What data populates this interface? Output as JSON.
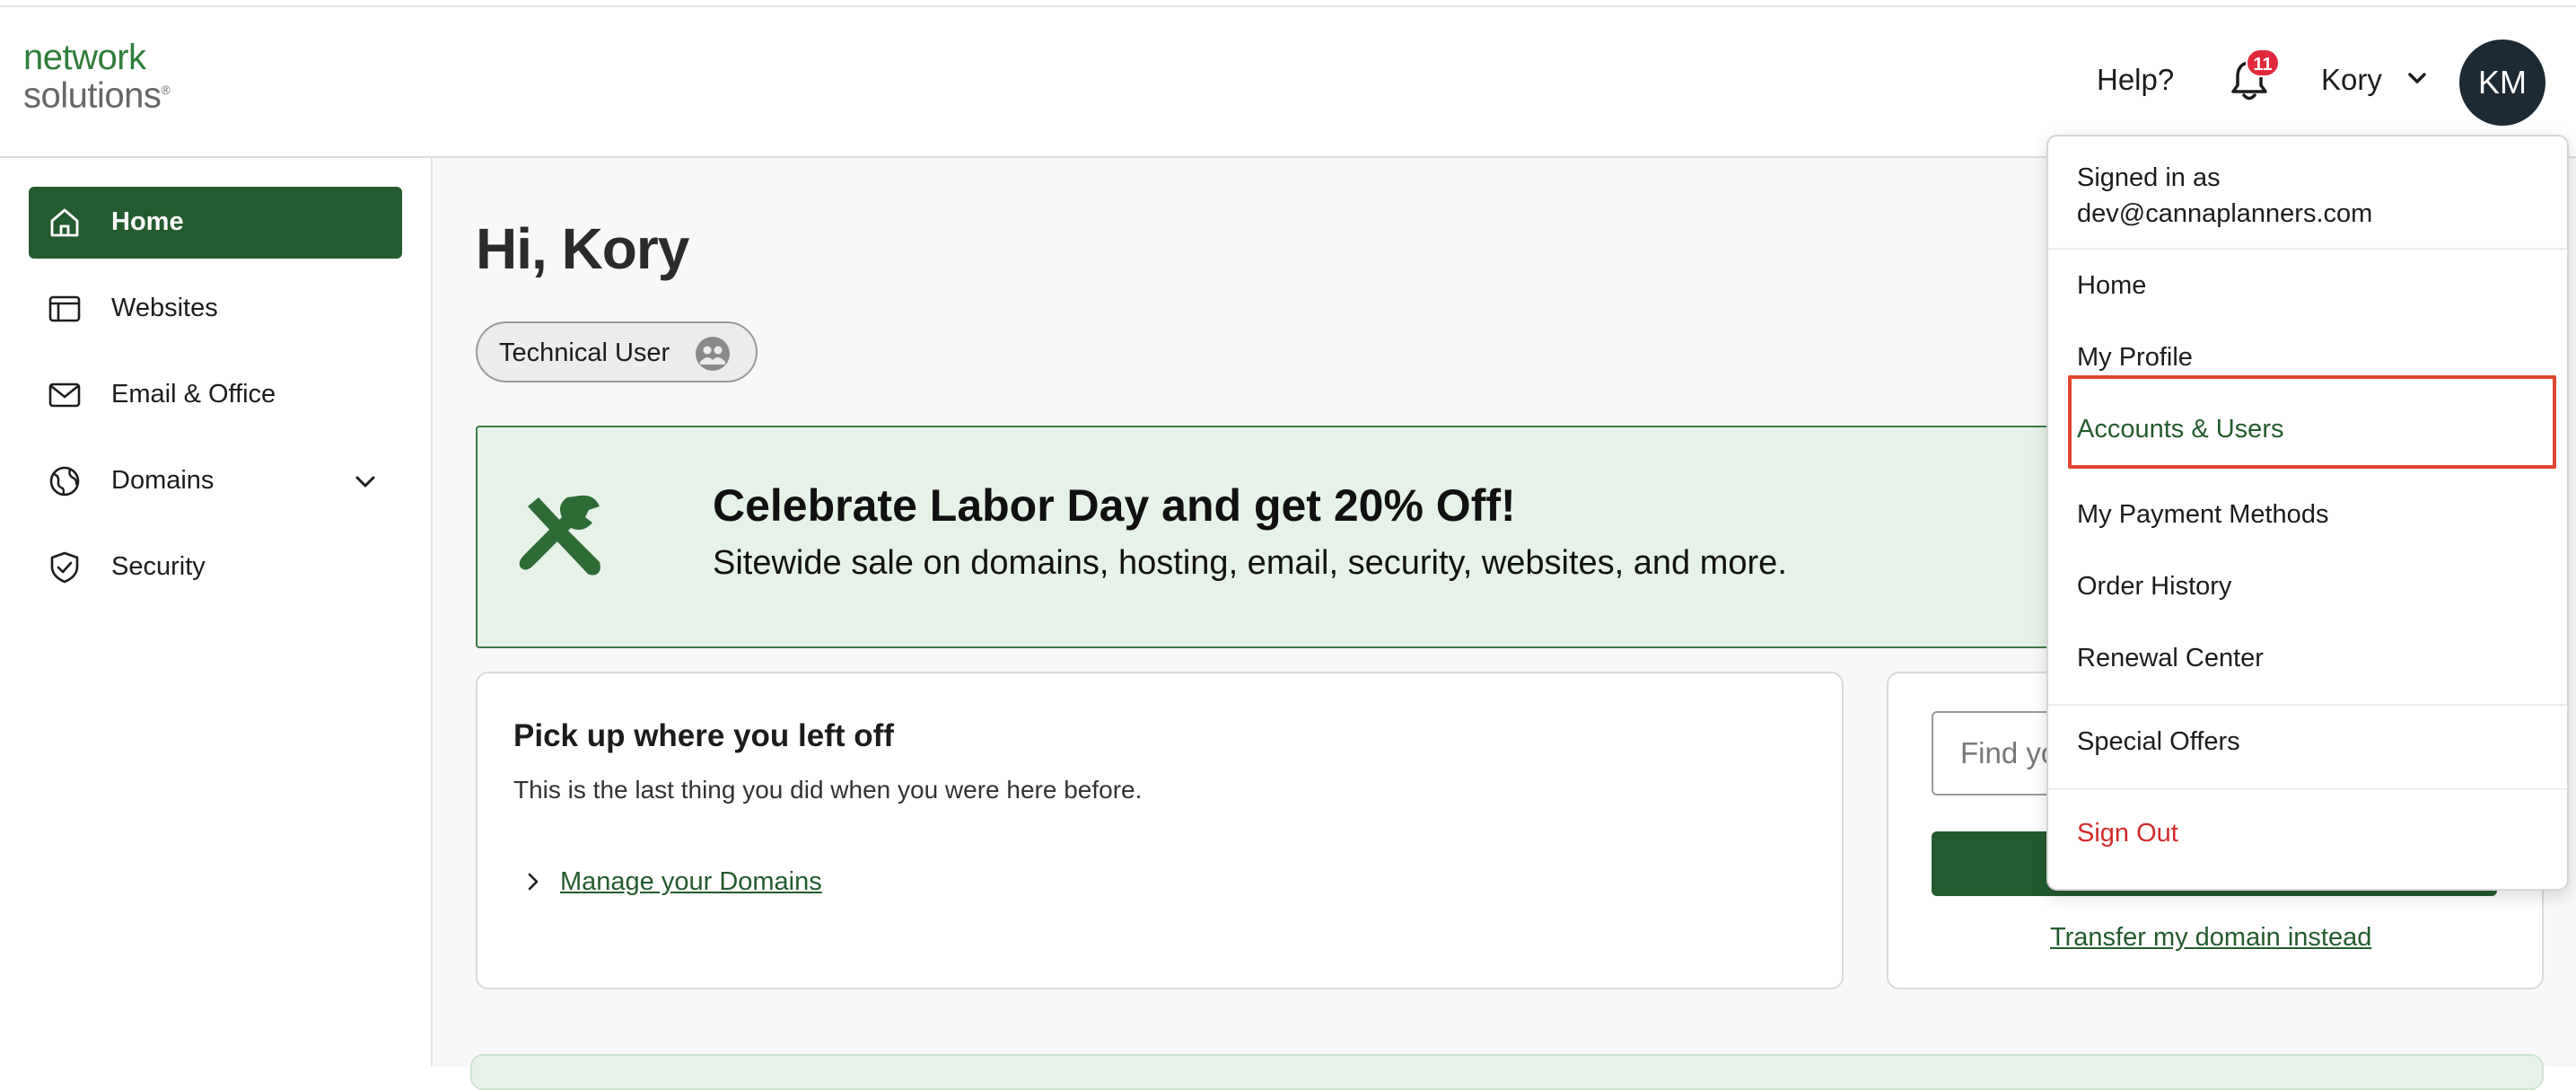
{
  "brand": {
    "logo_line1": "network",
    "logo_line2": "solutions",
    "logo_mark": "®",
    "primary_color": "#245b2e",
    "accent_color": "#2f7d3a"
  },
  "header": {
    "help_label": "Help?",
    "notification_count": "11",
    "user_name": "Kory",
    "avatar_initials": "KM",
    "icons": [
      "bell-icon",
      "chevron-down-icon"
    ]
  },
  "sidebar": {
    "items": [
      {
        "label": "Home",
        "icon": "home-icon",
        "active": true
      },
      {
        "label": "Websites",
        "icon": "browser-window-icon",
        "active": false
      },
      {
        "label": "Email & Office",
        "icon": "envelope-icon",
        "active": false
      },
      {
        "label": "Domains",
        "icon": "globe-icon",
        "active": false,
        "expandable": true
      },
      {
        "label": "Security",
        "icon": "shield-check-icon",
        "active": false
      }
    ]
  },
  "main": {
    "greeting": "Hi, Kory",
    "role_chip": "Technical User",
    "promo": {
      "title": "Celebrate Labor Day and get 20% Off!",
      "subtitle": "Sitewide sale on domains, hosting, email, security, websites, and more.",
      "icon": "tools-icon"
    },
    "resume_card": {
      "title": "Pick up where you left off",
      "subtitle": "This is the last thing you did when you were here before.",
      "link": "Manage your Domains"
    },
    "domain_card": {
      "search_placeholder": "Find your",
      "search_visible_text": "Find yo",
      "transfer_link": "Transfer my domain instead"
    }
  },
  "user_menu": {
    "signed_in_label": "Signed in as",
    "signed_in_email": "dev@cannaplanners.com",
    "items": [
      {
        "label": "Home"
      },
      {
        "label": "My Profile"
      },
      {
        "label": "Accounts & Users",
        "highlighted": true
      },
      {
        "label": "My Payment Methods"
      },
      {
        "label": "Order History"
      },
      {
        "label": "Renewal Center"
      },
      {
        "label": "Special Offers"
      },
      {
        "label": "Sign Out"
      }
    ],
    "highlight_color": "#e0452e",
    "signout_color": "#d12a2a"
  }
}
